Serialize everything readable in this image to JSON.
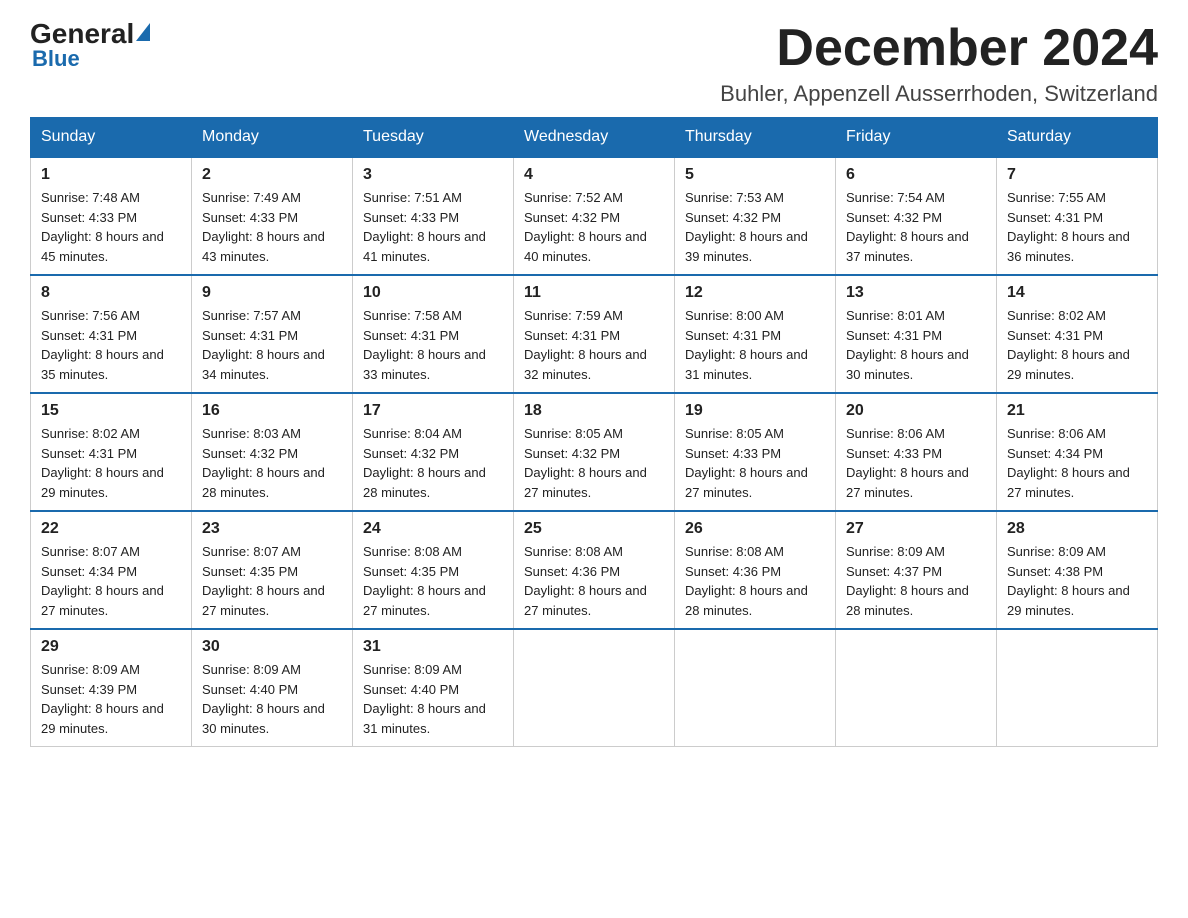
{
  "logo": {
    "general": "General",
    "blue": "Blue"
  },
  "title": "December 2024",
  "location": "Buhler, Appenzell Ausserrhoden, Switzerland",
  "days_of_week": [
    "Sunday",
    "Monday",
    "Tuesday",
    "Wednesday",
    "Thursday",
    "Friday",
    "Saturday"
  ],
  "weeks": [
    [
      {
        "day": "1",
        "sunrise": "7:48 AM",
        "sunset": "4:33 PM",
        "daylight": "8 hours and 45 minutes."
      },
      {
        "day": "2",
        "sunrise": "7:49 AM",
        "sunset": "4:33 PM",
        "daylight": "8 hours and 43 minutes."
      },
      {
        "day": "3",
        "sunrise": "7:51 AM",
        "sunset": "4:33 PM",
        "daylight": "8 hours and 41 minutes."
      },
      {
        "day": "4",
        "sunrise": "7:52 AM",
        "sunset": "4:32 PM",
        "daylight": "8 hours and 40 minutes."
      },
      {
        "day": "5",
        "sunrise": "7:53 AM",
        "sunset": "4:32 PM",
        "daylight": "8 hours and 39 minutes."
      },
      {
        "day": "6",
        "sunrise": "7:54 AM",
        "sunset": "4:32 PM",
        "daylight": "8 hours and 37 minutes."
      },
      {
        "day": "7",
        "sunrise": "7:55 AM",
        "sunset": "4:31 PM",
        "daylight": "8 hours and 36 minutes."
      }
    ],
    [
      {
        "day": "8",
        "sunrise": "7:56 AM",
        "sunset": "4:31 PM",
        "daylight": "8 hours and 35 minutes."
      },
      {
        "day": "9",
        "sunrise": "7:57 AM",
        "sunset": "4:31 PM",
        "daylight": "8 hours and 34 minutes."
      },
      {
        "day": "10",
        "sunrise": "7:58 AM",
        "sunset": "4:31 PM",
        "daylight": "8 hours and 33 minutes."
      },
      {
        "day": "11",
        "sunrise": "7:59 AM",
        "sunset": "4:31 PM",
        "daylight": "8 hours and 32 minutes."
      },
      {
        "day": "12",
        "sunrise": "8:00 AM",
        "sunset": "4:31 PM",
        "daylight": "8 hours and 31 minutes."
      },
      {
        "day": "13",
        "sunrise": "8:01 AM",
        "sunset": "4:31 PM",
        "daylight": "8 hours and 30 minutes."
      },
      {
        "day": "14",
        "sunrise": "8:02 AM",
        "sunset": "4:31 PM",
        "daylight": "8 hours and 29 minutes."
      }
    ],
    [
      {
        "day": "15",
        "sunrise": "8:02 AM",
        "sunset": "4:31 PM",
        "daylight": "8 hours and 29 minutes."
      },
      {
        "day": "16",
        "sunrise": "8:03 AM",
        "sunset": "4:32 PM",
        "daylight": "8 hours and 28 minutes."
      },
      {
        "day": "17",
        "sunrise": "8:04 AM",
        "sunset": "4:32 PM",
        "daylight": "8 hours and 28 minutes."
      },
      {
        "day": "18",
        "sunrise": "8:05 AM",
        "sunset": "4:32 PM",
        "daylight": "8 hours and 27 minutes."
      },
      {
        "day": "19",
        "sunrise": "8:05 AM",
        "sunset": "4:33 PM",
        "daylight": "8 hours and 27 minutes."
      },
      {
        "day": "20",
        "sunrise": "8:06 AM",
        "sunset": "4:33 PM",
        "daylight": "8 hours and 27 minutes."
      },
      {
        "day": "21",
        "sunrise": "8:06 AM",
        "sunset": "4:34 PM",
        "daylight": "8 hours and 27 minutes."
      }
    ],
    [
      {
        "day": "22",
        "sunrise": "8:07 AM",
        "sunset": "4:34 PM",
        "daylight": "8 hours and 27 minutes."
      },
      {
        "day": "23",
        "sunrise": "8:07 AM",
        "sunset": "4:35 PM",
        "daylight": "8 hours and 27 minutes."
      },
      {
        "day": "24",
        "sunrise": "8:08 AM",
        "sunset": "4:35 PM",
        "daylight": "8 hours and 27 minutes."
      },
      {
        "day": "25",
        "sunrise": "8:08 AM",
        "sunset": "4:36 PM",
        "daylight": "8 hours and 27 minutes."
      },
      {
        "day": "26",
        "sunrise": "8:08 AM",
        "sunset": "4:36 PM",
        "daylight": "8 hours and 28 minutes."
      },
      {
        "day": "27",
        "sunrise": "8:09 AM",
        "sunset": "4:37 PM",
        "daylight": "8 hours and 28 minutes."
      },
      {
        "day": "28",
        "sunrise": "8:09 AM",
        "sunset": "4:38 PM",
        "daylight": "8 hours and 29 minutes."
      }
    ],
    [
      {
        "day": "29",
        "sunrise": "8:09 AM",
        "sunset": "4:39 PM",
        "daylight": "8 hours and 29 minutes."
      },
      {
        "day": "30",
        "sunrise": "8:09 AM",
        "sunset": "4:40 PM",
        "daylight": "8 hours and 30 minutes."
      },
      {
        "day": "31",
        "sunrise": "8:09 AM",
        "sunset": "4:40 PM",
        "daylight": "8 hours and 31 minutes."
      },
      null,
      null,
      null,
      null
    ]
  ],
  "labels": {
    "sunrise": "Sunrise: ",
    "sunset": "Sunset: ",
    "daylight": "Daylight: "
  }
}
